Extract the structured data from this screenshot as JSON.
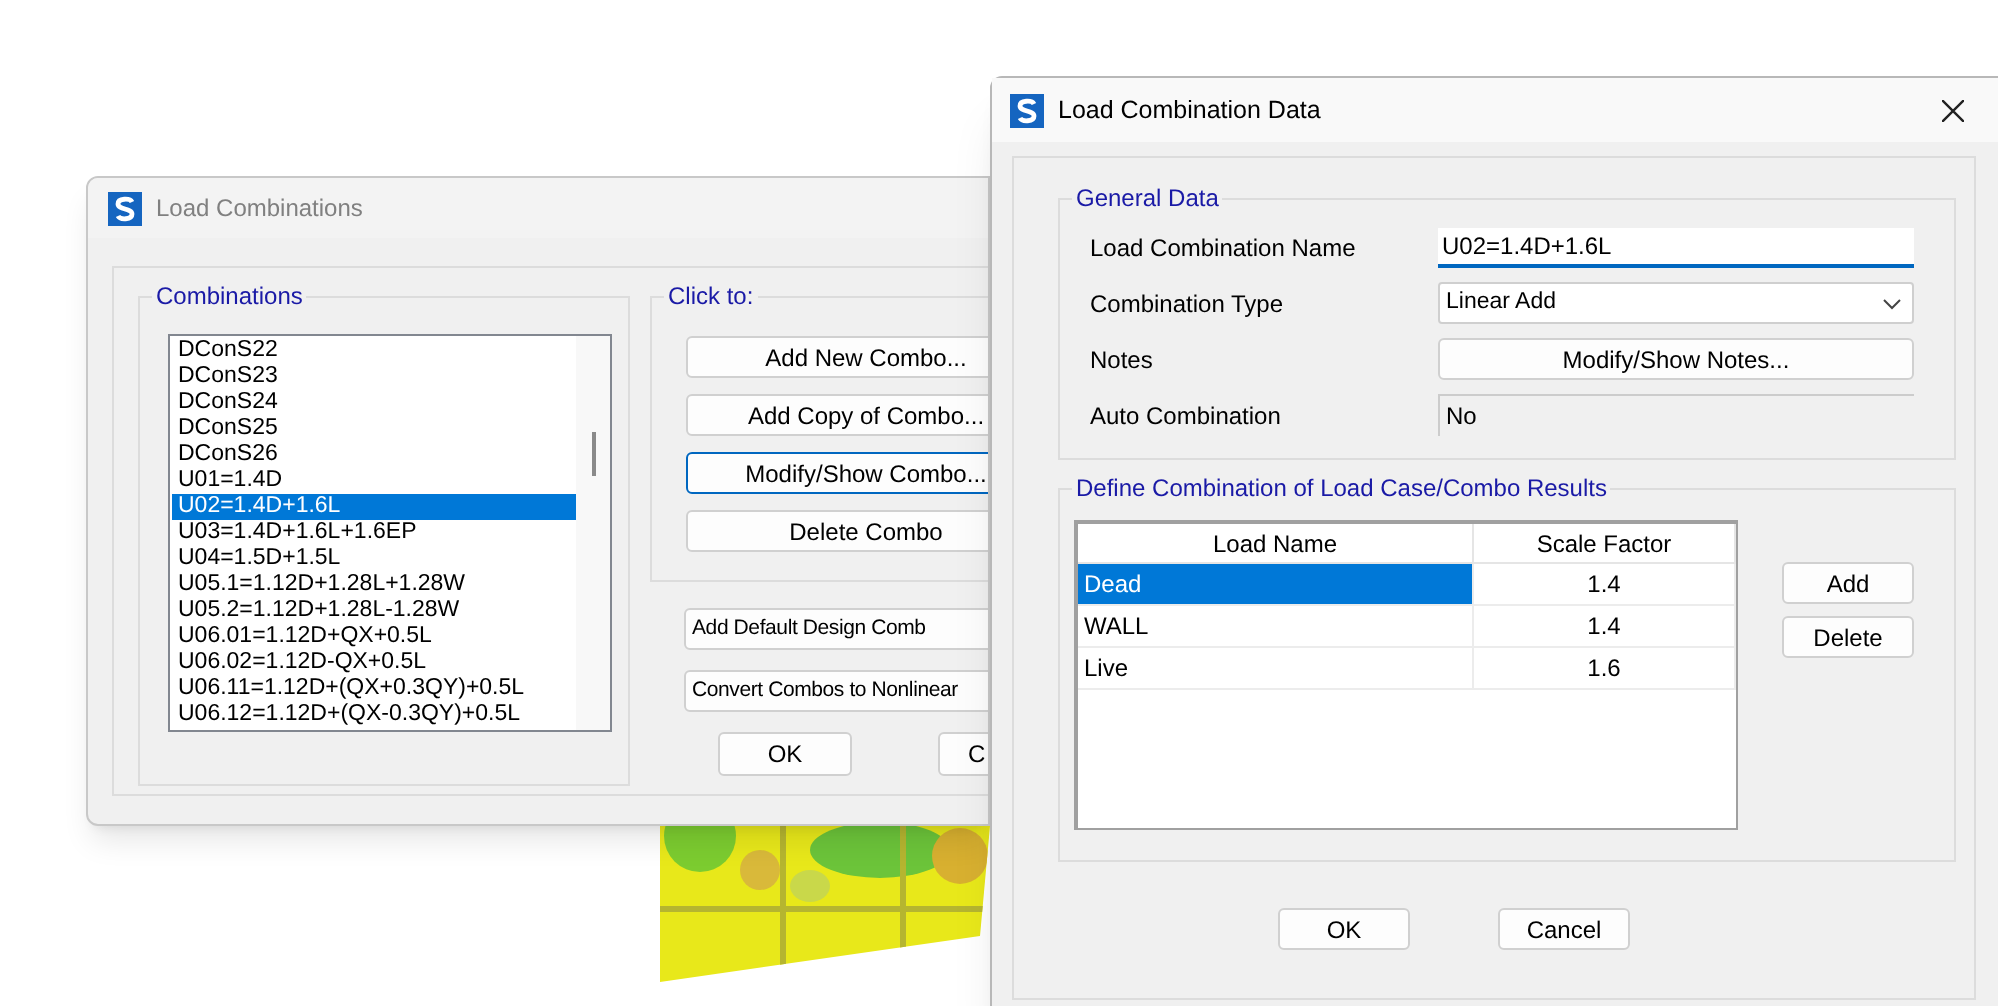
{
  "background_window": {
    "title": "Load Combinations",
    "combinations": {
      "label": "Combinations",
      "items": [
        {
          "text": "DConS22",
          "selected": false
        },
        {
          "text": "DConS23",
          "selected": false
        },
        {
          "text": "DConS24",
          "selected": false
        },
        {
          "text": "DConS25",
          "selected": false
        },
        {
          "text": "DConS26",
          "selected": false
        },
        {
          "text": "U01=1.4D",
          "selected": false
        },
        {
          "text": "U02=1.4D+1.6L",
          "selected": true
        },
        {
          "text": "U03=1.4D+1.6L+1.6EP",
          "selected": false
        },
        {
          "text": "U04=1.5D+1.5L",
          "selected": false
        },
        {
          "text": "U05.1=1.12D+1.28L+1.28W",
          "selected": false
        },
        {
          "text": "U05.2=1.12D+1.28L-1.28W",
          "selected": false
        },
        {
          "text": "U06.01=1.12D+QX+0.5L",
          "selected": false
        },
        {
          "text": "U06.02=1.12D-QX+0.5L",
          "selected": false
        },
        {
          "text": "U06.11=1.12D+(QX+0.3QY)+0.5L",
          "selected": false
        },
        {
          "text": "U06.12=1.12D+(QX-0.3QY)+0.5L",
          "selected": false
        }
      ]
    },
    "click_to": {
      "label": "Click to:",
      "buttons": [
        {
          "label": "Add New Combo...",
          "focused": false
        },
        {
          "label": "Add Copy of Combo...",
          "focused": false
        },
        {
          "label": "Modify/Show Combo...",
          "focused": true
        },
        {
          "label": "Delete Combo",
          "focused": false
        }
      ]
    },
    "buttons": [
      "Add Default Design Comb",
      "Convert Combos to Nonlinear"
    ],
    "ok": "OK",
    "cancel": "C"
  },
  "dialog": {
    "title": "Load Combination Data",
    "general_data": {
      "label": "General Data",
      "fields": [
        {
          "label": "Load Combination Name",
          "kind": "text",
          "value": "U02=1.4D+1.6L"
        },
        {
          "label": "Combination Type",
          "kind": "dropdown",
          "value": "Linear Add"
        },
        {
          "label": "Notes",
          "kind": "button",
          "value": "Modify/Show Notes..."
        },
        {
          "label": "Auto Combination",
          "kind": "readonly",
          "value": "No"
        }
      ]
    },
    "results": {
      "label": "Define Combination of Load Case/Combo Results",
      "columns": [
        "Load Name",
        "Scale Factor"
      ],
      "rows": [
        {
          "cells": [
            "Dead",
            "1.4"
          ],
          "selected": true
        },
        {
          "cells": [
            "WALL",
            "1.4"
          ],
          "selected": false
        },
        {
          "cells": [
            "Live",
            "1.6"
          ],
          "selected": false
        }
      ],
      "buttons": [
        "Add",
        "Delete"
      ]
    },
    "buttons": [
      "OK",
      "Cancel"
    ]
  }
}
